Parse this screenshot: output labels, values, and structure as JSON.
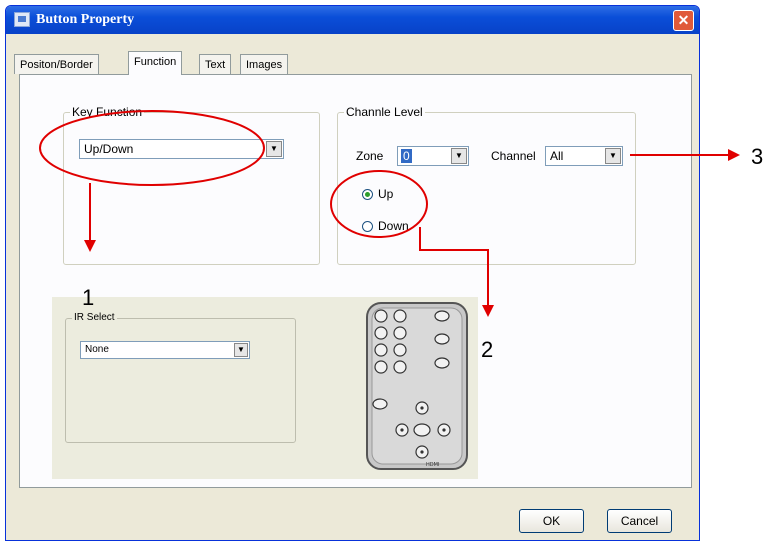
{
  "window": {
    "title": "Button Property",
    "close_glyph": "✕"
  },
  "tabs": [
    {
      "label": "Positon/Border"
    },
    {
      "label": "Function"
    },
    {
      "label": "Text"
    },
    {
      "label": "Images"
    }
  ],
  "key_function": {
    "group_label": "Key Function",
    "value": "Up/Down"
  },
  "channel_level": {
    "group_label": "Channle Level",
    "zone_label": "Zone",
    "zone_value": "0",
    "channel_label": "Channel",
    "channel_value": "All",
    "radio_up": "Up",
    "radio_down": "Down"
  },
  "ir_select": {
    "group_label": "IR Select",
    "value": "None"
  },
  "remote": {
    "brand_text": "HDMI"
  },
  "buttons": {
    "ok": "OK",
    "cancel": "Cancel"
  },
  "annotations": {
    "one": "1",
    "two": "2",
    "three": "3"
  },
  "colors": {
    "annotation": "#e00000",
    "titlebar": "#0a4ed8"
  }
}
